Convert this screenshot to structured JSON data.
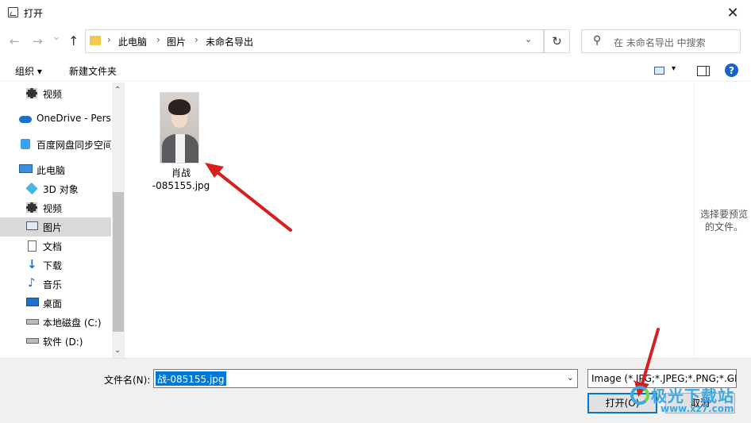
{
  "window": {
    "title": "打开",
    "close_glyph": "✕"
  },
  "nav": {
    "back_glyph": "←",
    "forward_glyph": "→",
    "recent_glyph": "⌄",
    "up_glyph": "↑",
    "breadcrumbs": [
      "此电脑",
      "图片",
      "未命名导出"
    ],
    "sep": "›",
    "dropdown_glyph": "⌄",
    "refresh_glyph": "↻",
    "search_placeholder": "在 未命名导出 中搜索",
    "search_glyph": "⚲"
  },
  "toolbar": {
    "organize": "组织 ▾",
    "new_folder": "新建文件夹",
    "help": "?",
    "view_dd": "▾"
  },
  "sidebar": {
    "items": [
      {
        "label": "视频",
        "icon": "film-icon"
      },
      {
        "label": "OneDrive - Perso",
        "icon": "cloud-icon"
      },
      {
        "label": "百度网盘同步空间",
        "icon": "baidu-cloud-icon"
      },
      {
        "label": "此电脑",
        "icon": "computer-icon"
      },
      {
        "label": "3D 对象",
        "icon": "cube-icon"
      },
      {
        "label": "视频",
        "icon": "film-icon"
      },
      {
        "label": "图片",
        "icon": "picture-icon",
        "selected": true
      },
      {
        "label": "文档",
        "icon": "document-icon"
      },
      {
        "label": "下载",
        "icon": "download-icon"
      },
      {
        "label": "音乐",
        "icon": "music-icon"
      },
      {
        "label": "桌面",
        "icon": "desktop-icon"
      },
      {
        "label": "本地磁盘 (C:)",
        "icon": "drive-icon"
      },
      {
        "label": "软件 (D:)",
        "icon": "drive-icon"
      }
    ],
    "scroll_up": "⌃",
    "scroll_down": "⌄"
  },
  "files": [
    {
      "name_line1": "肖战",
      "name_line2": "-085155.jpg"
    }
  ],
  "preview": {
    "text": "选择要预览的文件。"
  },
  "bottom": {
    "filename_label": "文件名(N):",
    "filename_value": "战-085155.jpg",
    "dropdown_glyph": "⌄",
    "file_type": "Image (*.JPG;*.JPEG;*.PNG;*.GIF)",
    "open_button": "打开(O)",
    "cancel_button": "取消"
  },
  "watermark": {
    "text": "极光下载站",
    "sub": "www.xz7.com"
  },
  "colors": {
    "accent": "#0078d7",
    "annotation_arrow": "#d61f1f",
    "watermark": "#3ca8e6"
  }
}
